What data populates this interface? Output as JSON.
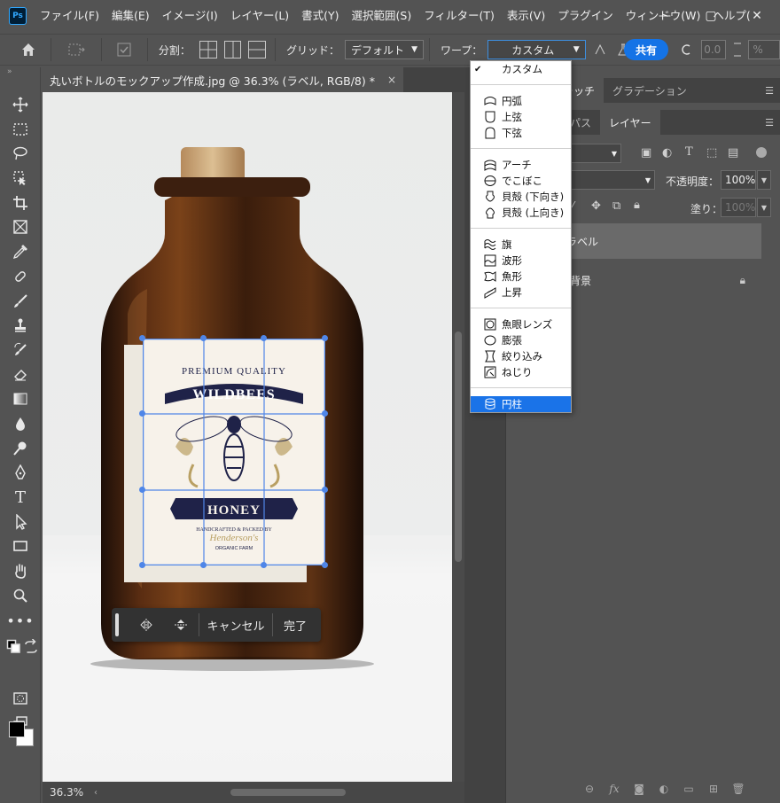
{
  "app": {
    "logo_text": "Ps"
  },
  "menubar": {
    "items": [
      "ファイル(F)",
      "編集(E)",
      "イメージ(I)",
      "レイヤー(L)",
      "書式(Y)",
      "選択範囲(S)",
      "フィルター(T)",
      "表示(V)",
      "プラグイン",
      "ウィンドウ(W)",
      "ヘルプ("
    ],
    "window_controls": [
      "—",
      "▢",
      "✕"
    ]
  },
  "optionsbar": {
    "split_label": "分割：",
    "grid_label": "グリッド：",
    "grid_value": "デフォルト",
    "warp_label": "ワープ：",
    "warp_value": "カスタム",
    "share_label": "共有",
    "bend_value": "0.0",
    "percent_value": "%"
  },
  "document": {
    "tab_title": "丸いボトルのモックアップ作成.jpg @ 36.3% (ラベル, RGB/8) *",
    "close_glyph": "×",
    "zoom": "36.3%"
  },
  "label_artwork": {
    "premium": "PREMIUM QUALITY",
    "brand": "WILDBEES",
    "product": "HONEY",
    "handcrafted": "HANDCRAFTED & PACKED BY",
    "signature": "Henderson's",
    "farm": "ORGANIC FARM"
  },
  "transform_bar": {
    "cancel_label": "キャンセル",
    "done_label": "完了"
  },
  "warp_menu": {
    "items": [
      {
        "label": "カスタム",
        "icon": "checkmark-icon",
        "checked": true
      },
      {
        "label": "円弧",
        "icon": "arc-icon"
      },
      {
        "label": "上弦",
        "icon": "arc-lower-icon"
      },
      {
        "label": "下弦",
        "icon": "arc-upper-icon"
      },
      {
        "label": "アーチ",
        "icon": "arch-icon"
      },
      {
        "label": "でこぼこ",
        "icon": "bulge-icon"
      },
      {
        "label": "貝殻 (下向き)",
        "icon": "shell-lower-icon"
      },
      {
        "label": "貝殻 (上向き)",
        "icon": "shell-upper-icon"
      },
      {
        "label": "旗",
        "icon": "flag-icon"
      },
      {
        "label": "波形",
        "icon": "wave-icon"
      },
      {
        "label": "魚形",
        "icon": "fish-icon"
      },
      {
        "label": "上昇",
        "icon": "rise-icon"
      },
      {
        "label": "魚眼レンズ",
        "icon": "fisheye-icon"
      },
      {
        "label": "膨張",
        "icon": "inflate-icon"
      },
      {
        "label": "絞り込み",
        "icon": "squeeze-icon"
      },
      {
        "label": "ねじり",
        "icon": "twist-icon"
      },
      {
        "label": "円柱",
        "icon": "cylinder-icon",
        "highlighted": true
      }
    ]
  },
  "panels": {
    "top_tabs": [
      "ウォッチ",
      "グラデーション"
    ],
    "layer_tabs": [
      "パス",
      "レイヤー"
    ],
    "opacity_label": "不透明度：",
    "opacity_value": "100%",
    "fill_label": "塗り：",
    "fill_value": "100%",
    "layers": [
      {
        "name": "ラベル",
        "selected": true
      },
      {
        "name": "背景",
        "locked": true
      }
    ]
  },
  "colors": {
    "accent": "#1473e6",
    "menu_highlight": "#1a73e8",
    "ui_bg": "#535353",
    "grid_line": "#4f86e8",
    "label_navy": "#1f2248",
    "label_gold": "#b9a063"
  }
}
